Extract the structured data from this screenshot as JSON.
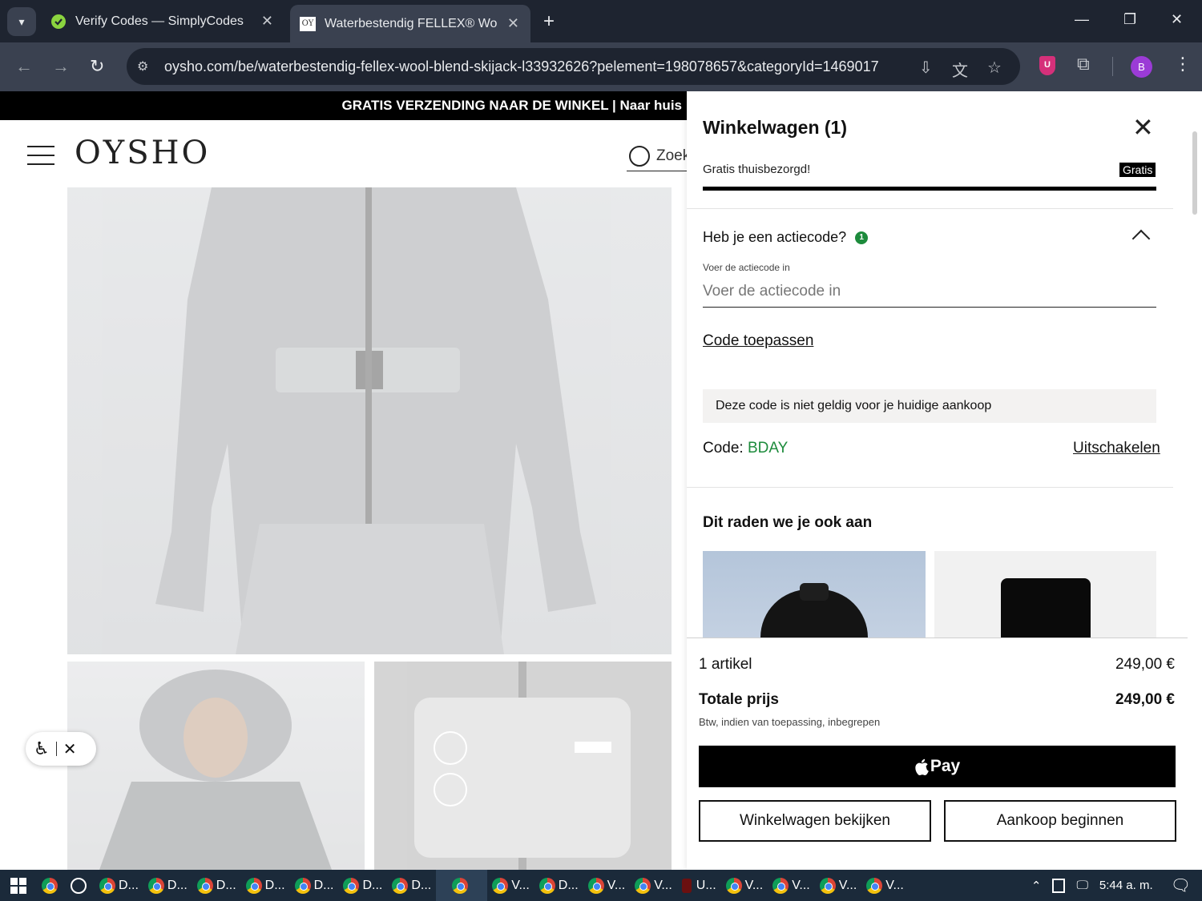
{
  "browser": {
    "tabs": [
      {
        "title": "Verify Codes — SimplyCodes",
        "active": false
      },
      {
        "title": "Waterbestendig FELLEX® Wool",
        "favicon_text": "OY",
        "active": true
      }
    ],
    "url": "oysho.com/be/waterbestendig-fellex-wool-blend-skijack-l33932626?pelement=198078657&categoryId=1469017",
    "profile_initial": "B",
    "shield_ext_letter": "U"
  },
  "site": {
    "promo_banner": "GRATIS VERZENDING NAAR DE WINKEL | Naar huis",
    "logo": "OYSHO",
    "search_text": "Zoek"
  },
  "cart": {
    "title": "Winkelwagen (1)",
    "shipping_text": "Gratis thuisbezorgd!",
    "shipping_badge": "Gratis",
    "shipping_progress": 1.0,
    "promo_question": "Heb je een actiecode?",
    "promo_count": "1",
    "promo_field_label": "Voer de actiecode in",
    "promo_placeholder": "Voer de actiecode in",
    "apply_label": "Code toepassen",
    "notice": "Deze code is niet geldig voor je huidige aankoop",
    "code_label": "Code:",
    "code_value": "BDAY",
    "disable_label": "Uitschakelen",
    "reco_title": "Dit raden we je ook aan",
    "summary": {
      "items_label": "1 artikel",
      "items_price": "249,00 €",
      "total_label": "Totale prijs",
      "total_price": "249,00 €",
      "vat_note": "Btw, indien van toepassing, inbegrepen"
    },
    "applepay_label": "Pay",
    "view_cart_label": "Winkelwagen bekijken",
    "checkout_label": "Aankoop beginnen"
  },
  "taskbar": {
    "items": [
      "D...",
      "D...",
      "D...",
      "D...",
      "D...",
      "D...",
      "D...",
      "",
      "V...",
      "D...",
      "V...",
      "V...",
      "U...",
      "V...",
      "V...",
      "V...",
      "V..."
    ],
    "clock": "5:44 a. m."
  },
  "colors": {
    "accent_green": "#1d8b3c",
    "chrome_dark": "#1e2430",
    "chrome_toolbar": "#3a4150",
    "taskbar": "#1b2a3a"
  }
}
